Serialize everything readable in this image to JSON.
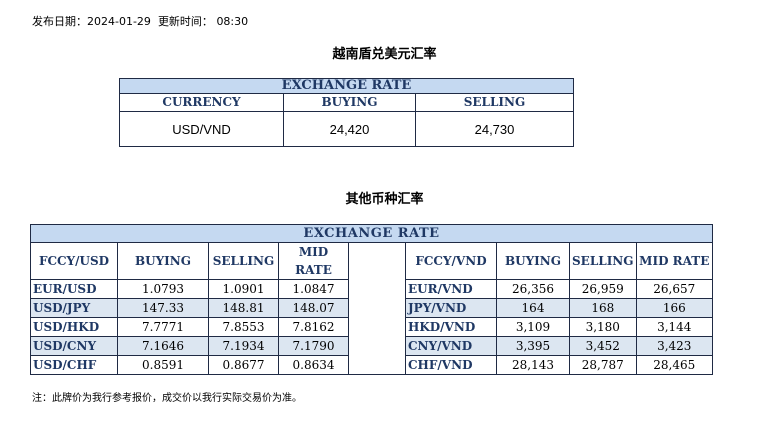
{
  "header": {
    "publish_label": "发布日期：",
    "publish_date": "2024-01-29",
    "update_label": "更新时间：",
    "update_time": "08:30"
  },
  "section1": {
    "title": "越南盾兑美元汇率",
    "table_title": "EXCHANGE RATE",
    "columns": [
      "CURRENCY",
      "BUYING",
      "SELLING"
    ],
    "row": [
      "USD/VND",
      "24,420",
      "24,730"
    ]
  },
  "section2": {
    "title": "其他币种汇率",
    "table_title": "EXCHANGE  RATE",
    "left_columns": [
      "FCCY/USD",
      "BUYING",
      "SELLING",
      "MID RATE"
    ],
    "right_columns": [
      "FCCY/VND",
      "BUYING",
      "SELLING",
      "MID RATE"
    ],
    "left_rows": [
      [
        "EUR/USD",
        "1.0793",
        "1.0901",
        "1.0847"
      ],
      [
        "USD/JPY",
        "147.33",
        "148.81",
        "148.07"
      ],
      [
        "USD/HKD",
        "7.7771",
        "7.8553",
        "7.8162"
      ],
      [
        "USD/CNY",
        "7.1646",
        "7.1934",
        "7.1790"
      ],
      [
        "USD/CHF",
        "0.8591",
        "0.8677",
        "0.8634"
      ]
    ],
    "right_rows": [
      [
        "EUR/VND",
        "26,356",
        "26,959",
        "26,657"
      ],
      [
        "JPY/VND",
        "164",
        "168",
        "166"
      ],
      [
        "HKD/VND",
        "3,109",
        "3,180",
        "3,144"
      ],
      [
        "CNY/VND",
        "3,395",
        "3,452",
        "3,423"
      ],
      [
        "CHF/VND",
        "28,143",
        "28,787",
        "28,465"
      ]
    ]
  },
  "note": "注：此牌价为我行参考报价，成交价以我行实际交易价为准。",
  "colors": {
    "header_fill": "#c5d9f1",
    "alt_row_fill": "#dce6f1",
    "header_text": "#1f3864",
    "border": "#1f2a44"
  }
}
